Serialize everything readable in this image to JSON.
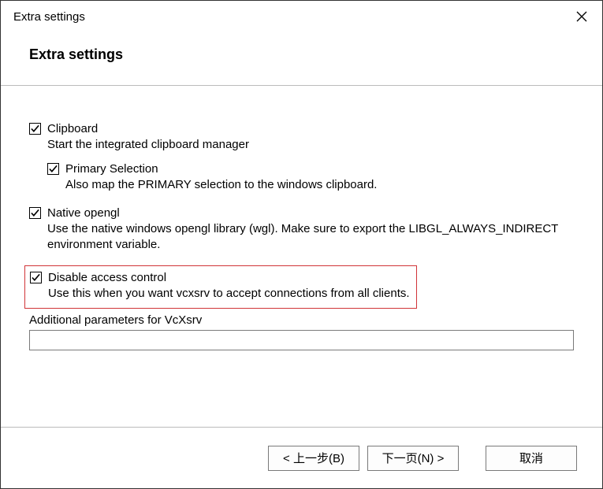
{
  "window": {
    "title": "Extra settings"
  },
  "header": {
    "title": "Extra settings"
  },
  "options": {
    "clipboard": {
      "label": "Clipboard",
      "desc": "Start the integrated clipboard manager",
      "checked": true
    },
    "primary": {
      "label": "Primary Selection",
      "desc": "Also map the PRIMARY selection to the windows clipboard.",
      "checked": true
    },
    "opengl": {
      "label": "Native opengl",
      "desc": "Use the native windows opengl library (wgl). Make sure to export the LIBGL_ALWAYS_INDIRECT environment variable.",
      "checked": true
    },
    "access": {
      "label": "Disable access control",
      "desc": "Use this when you want vcxsrv to accept connections from all clients.",
      "checked": true
    }
  },
  "additional": {
    "label": "Additional parameters for VcXsrv",
    "value": ""
  },
  "footer": {
    "back": "< 上一步(B)",
    "next": "下一页(N) >",
    "cancel": "取消"
  }
}
